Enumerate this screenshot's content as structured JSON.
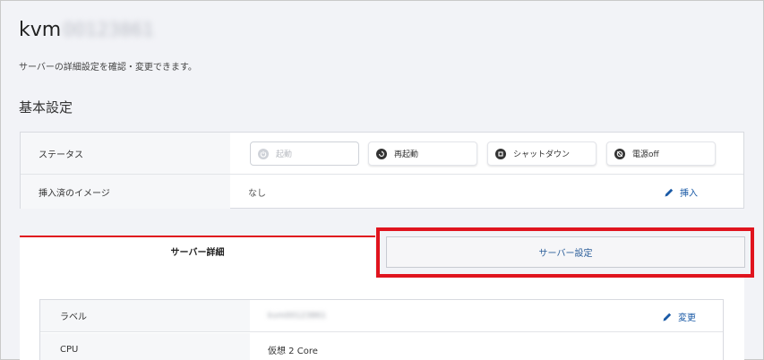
{
  "server": {
    "name_prefix": "kvm",
    "name_redacted": "00123861",
    "subtitle": "サーバーの詳細設定を確認・変更できます。"
  },
  "basic_settings": {
    "heading": "基本設定",
    "status_label": "ステータス",
    "buttons": {
      "start": "起動",
      "restart": "再起動",
      "shutdown": "シャットダウン",
      "power_off": "電源off"
    },
    "image_label": "挿入済のイメージ",
    "image_value": "なし",
    "insert_label": "挿入"
  },
  "tabs": {
    "detail": "サーバー詳細",
    "settings": "サーバー設定"
  },
  "details": {
    "label_key": "ラベル",
    "label_value_redacted": "kvm00123861",
    "change_label": "変更",
    "cpu_key": "CPU",
    "cpu_value": "仮想 2 Core"
  },
  "colors": {
    "accent_red": "#e0141e",
    "link_blue": "#1a5aa6"
  },
  "icons": {
    "start": "power-icon",
    "restart": "restart-icon",
    "shutdown": "stop-icon",
    "power_off": "power-off-icon",
    "edit": "pencil-icon"
  }
}
